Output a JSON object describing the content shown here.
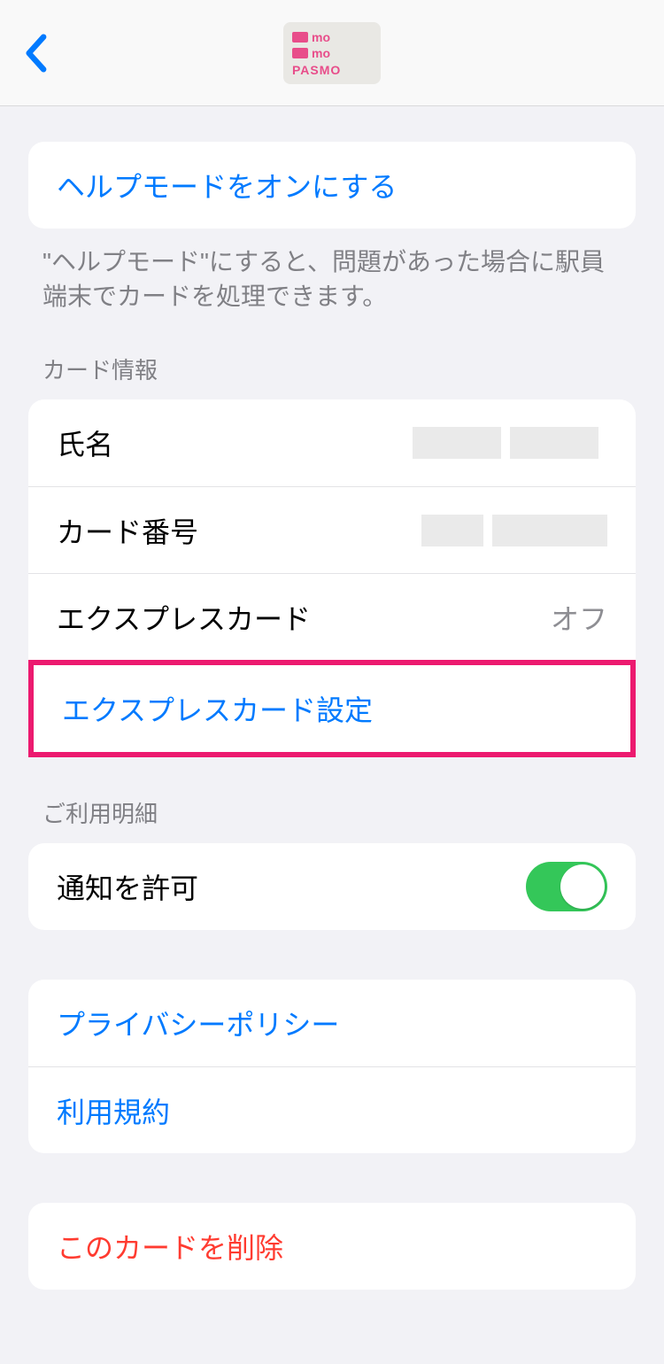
{
  "card_logo": {
    "line1": "mo",
    "line2": "mo",
    "line3": "PASMO"
  },
  "help_mode": {
    "button_label": "ヘルプモードをオンにする",
    "description": "\"ヘルプモード\"にすると、問題があった場合に駅員端末でカードを処理できます。"
  },
  "card_info": {
    "header": "カード情報",
    "name_label": "氏名",
    "number_label": "カード番号",
    "express_label": "エクスプレスカード",
    "express_value": "オフ",
    "express_settings_label": "エクスプレスカード設定"
  },
  "usage": {
    "header": "ご利用明細",
    "notification_label": "通知を許可",
    "notification_on": true
  },
  "links": {
    "privacy": "プライバシーポリシー",
    "terms": "利用規約"
  },
  "delete": {
    "label": "このカードを削除"
  }
}
